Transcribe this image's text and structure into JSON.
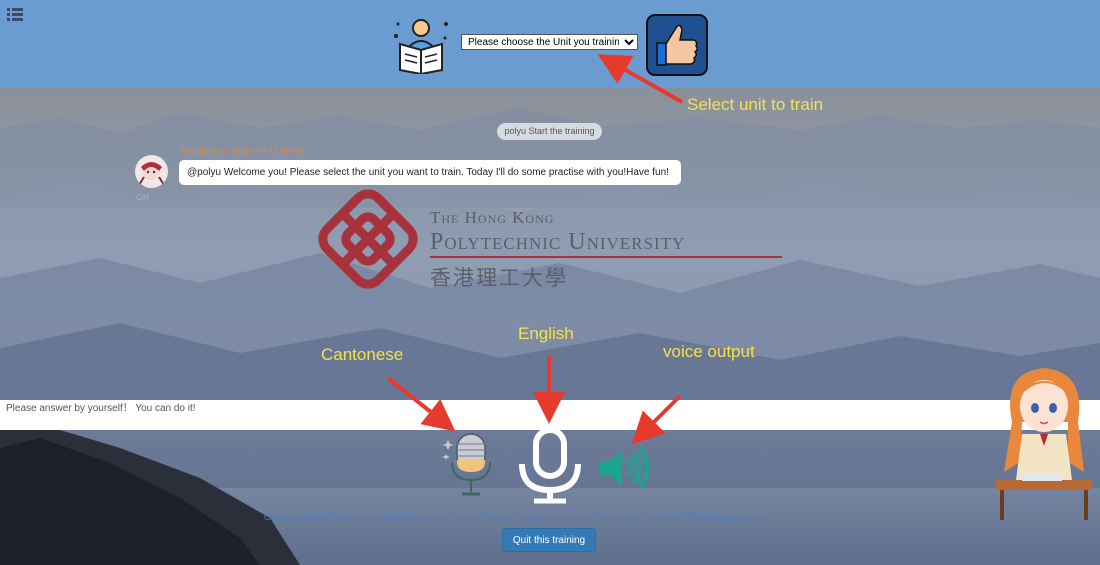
{
  "header": {
    "menu_icon": "list-icon",
    "reader_icon": "person-reading-icon",
    "unit_select": {
      "selected": "Please choose the Unit you training",
      "options": [
        "Please choose the Unit you training"
      ]
    },
    "confirm_icon": "thumbs-up-icon"
  },
  "annotations": {
    "select_unit": "Select unit to train",
    "cantonese": "Cantonese",
    "english": "English",
    "voice_output": "voice output"
  },
  "chat": {
    "system_message": "polyu Start the training",
    "meta": "Rongyong ⏲ 2021-07-11 20:06",
    "avatar_name": "Girl",
    "message": "@polyu Welcome you! Please select the unit you want to train. Today I'll do some practise with you!Have fun!"
  },
  "logo": {
    "line1": "The Hong Kong",
    "line2": "Polytechnic University",
    "line3": "香港理工大學"
  },
  "answer_input": {
    "placeholder": "Please answer by yourself！ You can do it!"
  },
  "controls": {
    "cantonese_icon": "vintage-microphone-icon",
    "english_icon": "microphone-icon",
    "voice_icon": "speaker-volume-icon"
  },
  "footer": {
    "copyright": "Copyright©2021 Polyu Social Media Analysis Research Group. All rights reserved. Connect me: zzh15521280455@gmail.com",
    "quit_label": "Quit this training"
  },
  "colors": {
    "header_bg": "#6a9bd1",
    "annotation": "#f5e24a",
    "arrow": "#e53a2c",
    "button": "#337ab7",
    "logo_red": "#a8323b"
  }
}
